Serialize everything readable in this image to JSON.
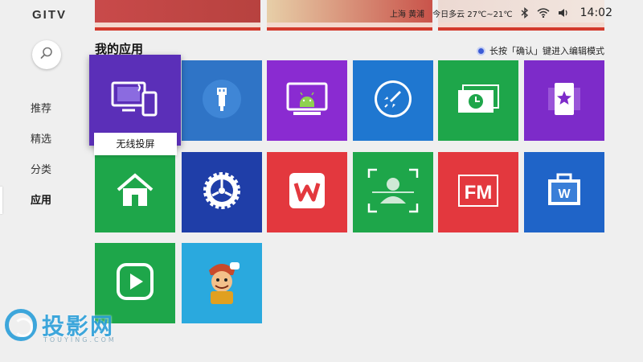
{
  "status": {
    "brand_logo": "GITV",
    "location": "上海 黄浦",
    "weather": "今日多云 27℃~21℃",
    "time": "14:02"
  },
  "nav": {
    "items": [
      {
        "label": "推荐"
      },
      {
        "label": "精选"
      },
      {
        "label": "分类"
      },
      {
        "label": "应用"
      }
    ],
    "active": "应用"
  },
  "main": {
    "title": "我的应用",
    "hint": "长按「确认」键进入编辑模式",
    "focused_caption": "无线投屏",
    "tiles": [
      {
        "icon": "screen-mirror-icon",
        "color": "#5b2fb8"
      },
      {
        "icon": "usb-icon",
        "color": "#2f74c6"
      },
      {
        "icon": "android-icon",
        "color": "#8a2bd1"
      },
      {
        "icon": "rocket-icon",
        "color": "#1f77d0"
      },
      {
        "icon": "clock-money-icon",
        "color": "#1ea64a"
      },
      {
        "icon": "star-card-icon",
        "color": "#7d2bc9"
      },
      {
        "icon": "home-icon",
        "color": "#1ea64a"
      },
      {
        "icon": "settings-gear-icon",
        "color": "#1f3ea8"
      },
      {
        "icon": "wps-icon",
        "color": "#e3383e"
      },
      {
        "icon": "face-scan-icon",
        "color": "#1ea64a"
      },
      {
        "icon": "fm-radio-icon",
        "color": "#e3383e"
      },
      {
        "icon": "word-doc-icon",
        "color": "#1f64c8"
      },
      {
        "icon": "video-player-icon",
        "color": "#1ea64a"
      },
      {
        "icon": "game-character-icon",
        "color": "#2aa9de"
      }
    ]
  },
  "watermark": {
    "text": "投影网",
    "sub": "TOUYING.COM"
  }
}
